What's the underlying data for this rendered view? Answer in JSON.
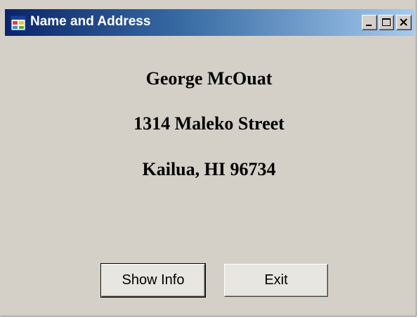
{
  "window": {
    "title": "Name and Address",
    "icon": "app-form-icon",
    "controls": {
      "minimize": "minimize-icon",
      "maximize": "maximize-icon",
      "close": "close-icon"
    }
  },
  "address": {
    "name": "George McOuat",
    "street": "1314 Maleko Street",
    "city_state_zip": "Kailua, HI  96734"
  },
  "buttons": {
    "show_info": "Show Info",
    "exit": "Exit"
  },
  "colors": {
    "titlebar_start": "#0a246a",
    "titlebar_end": "#a6caf0",
    "face": "#d4d0c8"
  }
}
